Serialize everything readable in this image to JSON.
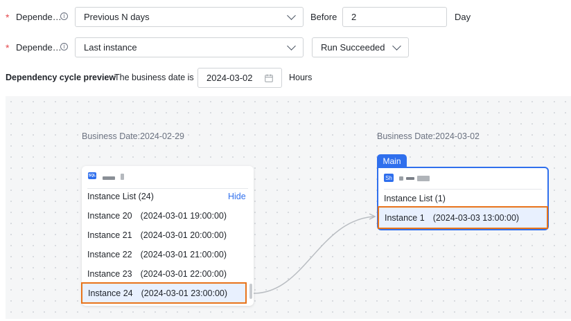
{
  "form": {
    "row1": {
      "label": "Depende…",
      "select_value": "Previous N days",
      "before_label": "Before",
      "n_value": "2",
      "unit": "Day"
    },
    "row2": {
      "label": "Depende…",
      "select_value": "Last instance",
      "status_value": "Run Succeeded"
    },
    "preview": {
      "title": "Dependency cycle preview",
      "business_date_label": "The business date is",
      "date_value": "2024-03-02",
      "unit": "Hours"
    }
  },
  "graph": {
    "left_node": {
      "business_date": "Business Date:2024-02-29",
      "badge": "SQL",
      "instance_list_title": "Instance List (24)",
      "hide_label": "Hide",
      "instances": [
        {
          "name": "Instance 20",
          "time": "(2024-03-01 19:00:00)"
        },
        {
          "name": "Instance 21",
          "time": "(2024-03-01 20:00:00)"
        },
        {
          "name": "Instance 22",
          "time": "(2024-03-01 21:00:00)"
        },
        {
          "name": "Instance 23",
          "time": "(2024-03-01 22:00:00)"
        },
        {
          "name": "Instance 24",
          "time": "(2024-03-01 23:00:00)"
        }
      ],
      "selected_index": 4
    },
    "right_node": {
      "business_date": "Business Date:2024-03-02",
      "tag": "Main",
      "badge": "Sh",
      "instance_list_title": "Instance List (1)",
      "instances": [
        {
          "name": "Instance 1",
          "time": "(2024-03-03 13:00:00)"
        }
      ],
      "selected_index": 0
    }
  },
  "colors": {
    "accent": "#2f6fed",
    "highlight_border": "#e8731a",
    "selected_row_bg": "#e8f0fe",
    "required": "#e5484d"
  },
  "icons": [
    "info-icon",
    "chevron-down-icon",
    "calendar-icon",
    "sql-node-icon",
    "shell-node-icon"
  ]
}
